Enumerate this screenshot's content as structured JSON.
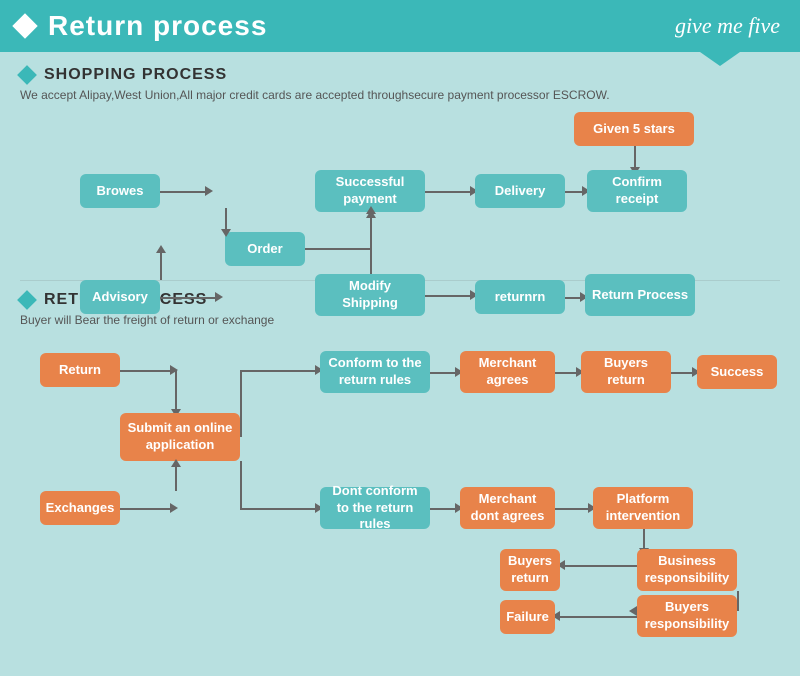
{
  "header": {
    "title": "Return process",
    "brand": "give me five",
    "diamond_label": "header-diamond"
  },
  "shopping": {
    "section_title": "SHOPPING PROCESS",
    "description": "We accept Alipay,West Union,All major credit cards are accepted throughsecure payment processor ESCROW.",
    "boxes": {
      "browes": "Browes",
      "order": "Order",
      "advisory": "Advisory",
      "modify_shipping": "Modify Shipping",
      "successful_payment": "Successful payment",
      "delivery": "Delivery",
      "confirm_receipt": "Confirm receipt",
      "given_5_stars": "Given 5 stars",
      "returnrn": "returnrn",
      "return_process": "Return Process"
    }
  },
  "return_process": {
    "section_title": "RETURN PROCESS",
    "description": "Buyer will Bear the freight of return or exchange",
    "boxes": {
      "return": "Return",
      "exchanges": "Exchanges",
      "submit_online": "Submit an online application",
      "conform_rules": "Conform to the return rules",
      "dont_conform": "Dont conform to the return rules",
      "merchant_agrees": "Merchant agrees",
      "merchant_dont": "Merchant dont agrees",
      "buyers_return_1": "Buyers return",
      "buyers_return_2": "Buyers return",
      "platform": "Platform intervention",
      "success": "Success",
      "business_resp": "Business responsibility",
      "buyers_resp": "Buyers responsibility",
      "failure": "Failure"
    }
  }
}
